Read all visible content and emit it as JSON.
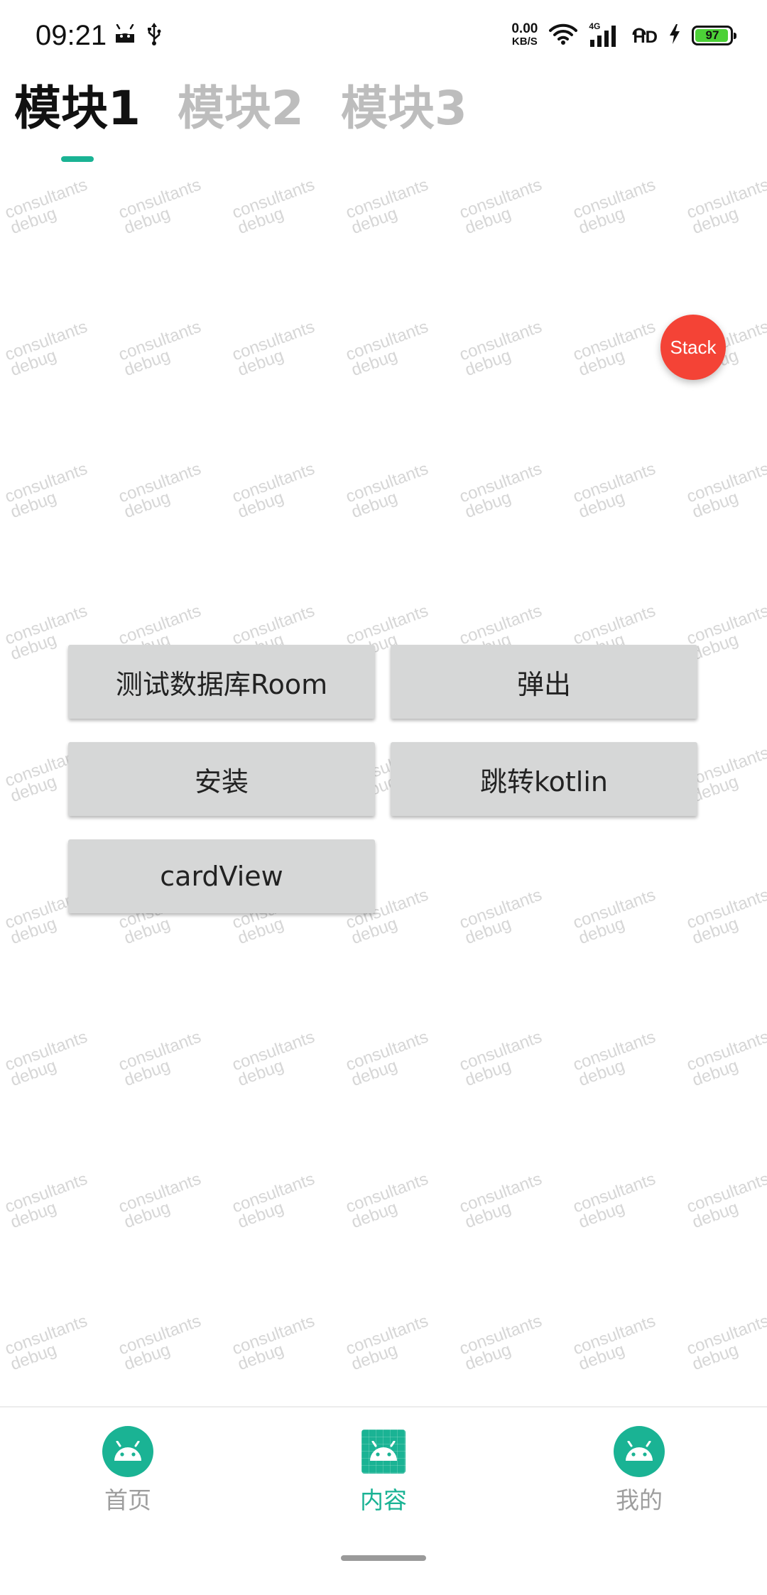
{
  "status_bar": {
    "time": "09:21",
    "net_speed_value": "0.00",
    "net_speed_unit": "KB/S",
    "signal_label": "4G",
    "hd_label": "HD",
    "battery_level": "97",
    "battery_fraction": 0.97,
    "battery_color": "#4cd137",
    "icons": [
      "android-icon",
      "usb-icon",
      "wifi-icon",
      "signal-icon",
      "hd-icon",
      "charging-icon",
      "battery-icon"
    ]
  },
  "tabs": [
    {
      "label": "模块1",
      "active": true
    },
    {
      "label": "模块2",
      "active": false
    },
    {
      "label": "模块3",
      "active": false
    }
  ],
  "fab": {
    "label": "Stack",
    "color": "#f44336"
  },
  "buttons": [
    {
      "label": "测试数据库Room"
    },
    {
      "label": "弹出"
    },
    {
      "label": "安装"
    },
    {
      "label": "跳转kotlin"
    },
    {
      "label": "cardView"
    }
  ],
  "watermark": {
    "line1": "consultants",
    "line2": "debug"
  },
  "bottom_nav": [
    {
      "label": "首页",
      "icon": "android-icon",
      "active": false
    },
    {
      "label": "内容",
      "icon": "android-icon",
      "active": true
    },
    {
      "label": "我的",
      "icon": "android-icon",
      "active": false
    }
  ],
  "colors": {
    "accent": "#1ab394",
    "inactive": "#9e9e9e",
    "button_bg": "#d6d7d7"
  }
}
